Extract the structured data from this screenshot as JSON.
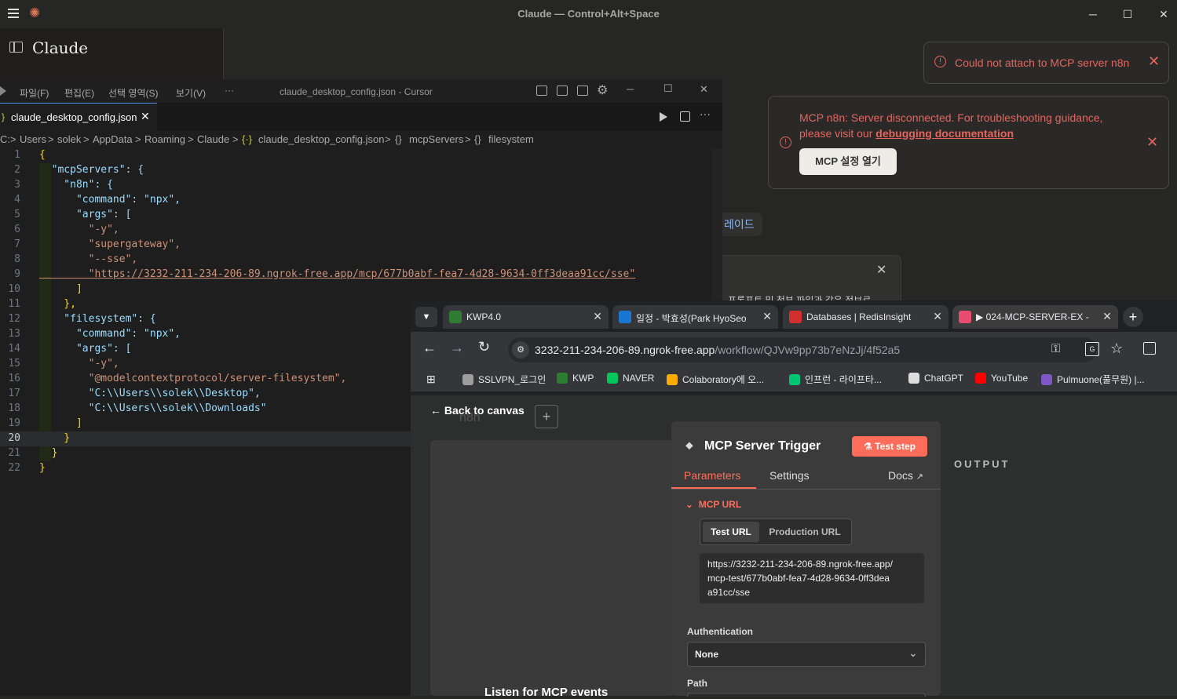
{
  "claude": {
    "window_title": "Claude — Control+Alt+Space",
    "app_name": "Claude",
    "toast_attach": "Could not attach to MCP server n8n",
    "toast_disconnect_line1": "MCP n8n: Server disconnected. For troubleshooting guidance,",
    "toast_disconnect_line2_prefix": "please visit our ",
    "toast_disconnect_link": "debugging documentation",
    "toast_button": "MCP 설정 열기",
    "upgrade_fragment": "레이드",
    "behind_text": "프롬프트 및 첨부 파일과 같은 정보로"
  },
  "cursor": {
    "menu": [
      "파일(F)",
      "편집(E)",
      "선택 영역(S)",
      "보기(V)",
      "···"
    ],
    "title": "claude_desktop_config.json - Cursor",
    "tab_label": "claude_desktop_config.json",
    "breadcrumb": [
      "C:",
      "Users",
      "solek",
      "AppData",
      "Roaming",
      "Claude",
      "claude_desktop_config.json",
      "mcpServers",
      "filesystem"
    ],
    "current_line": "20",
    "code_lines": [
      {
        "n": "1",
        "t": "{"
      },
      {
        "n": "2",
        "t": "  \"mcpServers\": {"
      },
      {
        "n": "3",
        "t": "    \"n8n\": {"
      },
      {
        "n": "4",
        "t": "      \"command\": \"npx\","
      },
      {
        "n": "5",
        "t": "      \"args\": ["
      },
      {
        "n": "6",
        "t": "        \"-y\","
      },
      {
        "n": "7",
        "t": "        \"supergateway\","
      },
      {
        "n": "8",
        "t": "        \"--sse\","
      },
      {
        "n": "9",
        "t": "        \"https://3232-211-234-206-89.ngrok-free.app/mcp/677b0abf-fea7-4d28-9634-0ff3deaa91cc/sse\""
      },
      {
        "n": "10",
        "t": "      ]"
      },
      {
        "n": "11",
        "t": "    },"
      },
      {
        "n": "12",
        "t": "    \"filesystem\": {"
      },
      {
        "n": "13",
        "t": "      \"command\": \"npx\","
      },
      {
        "n": "14",
        "t": "      \"args\": ["
      },
      {
        "n": "15",
        "t": "        \"-y\","
      },
      {
        "n": "16",
        "t": "        \"@modelcontextprotocol/server-filesystem\","
      },
      {
        "n": "17",
        "t": "        \"C:\\\\Users\\\\solek\\\\Desktop\","
      },
      {
        "n": "18",
        "t": "        \"C:\\\\Users\\\\solek\\\\Downloads\""
      },
      {
        "n": "19",
        "t": "      ]"
      },
      {
        "n": "20",
        "t": "    }"
      },
      {
        "n": "21",
        "t": "  }"
      },
      {
        "n": "22",
        "t": "}"
      }
    ]
  },
  "chrome": {
    "tabs": [
      {
        "label": "KWP4.0",
        "color": "#2e7d32"
      },
      {
        "label": "일정 - 박효성(Park HyoSeo",
        "color": "#1976d2"
      },
      {
        "label": "Databases | RedisInsight",
        "color": "#d32f2f"
      },
      {
        "label": "▶ 024-MCP-SERVER-EX -",
        "color": "#ea4b71"
      }
    ],
    "url_host": "3232-211-234-206-89.ngrok-free.app",
    "url_path": "/workflow/QJVw9pp73b7eNzJj/4f52a5",
    "bookmarks": [
      {
        "label": "SSLVPN_로그인",
        "color": "#9e9e9e"
      },
      {
        "label": "KWP",
        "color": "#2e7d32"
      },
      {
        "label": "NAVER",
        "color": "#03c75a"
      },
      {
        "label": "Colaboratory에 오...",
        "color": "#f9ab00"
      },
      {
        "label": "인프런 - 라이프타...",
        "color": "#00c471"
      },
      {
        "label": "ChatGPT",
        "color": "#dddddd"
      },
      {
        "label": "YouTube",
        "color": "#ff0000"
      },
      {
        "label": "Pulmuone(풀무원) |...",
        "color": "#7e57c2"
      }
    ]
  },
  "n8n": {
    "back": "Back to canvas",
    "logo_text": "n8n",
    "node_title": "MCP Server Trigger",
    "test_step": "Test step",
    "tab_parameters": "Parameters",
    "tab_settings": "Settings",
    "tab_docs": "Docs",
    "section_mcp_url": "MCP URL",
    "url_test": "Test URL",
    "url_production": "Production URL",
    "url_value_1": "https://3232-211-234-206-89.ngrok-free.app/",
    "url_value_2": "mcp-test/677b0abf-fea7-4d28-9634-0ff3dea",
    "url_value_3": "a91cc/sse",
    "auth_label": "Authentication",
    "auth_value": "None",
    "path_label": "Path",
    "output_label": "OUTPUT",
    "listen_text": "Listen for MCP events"
  }
}
